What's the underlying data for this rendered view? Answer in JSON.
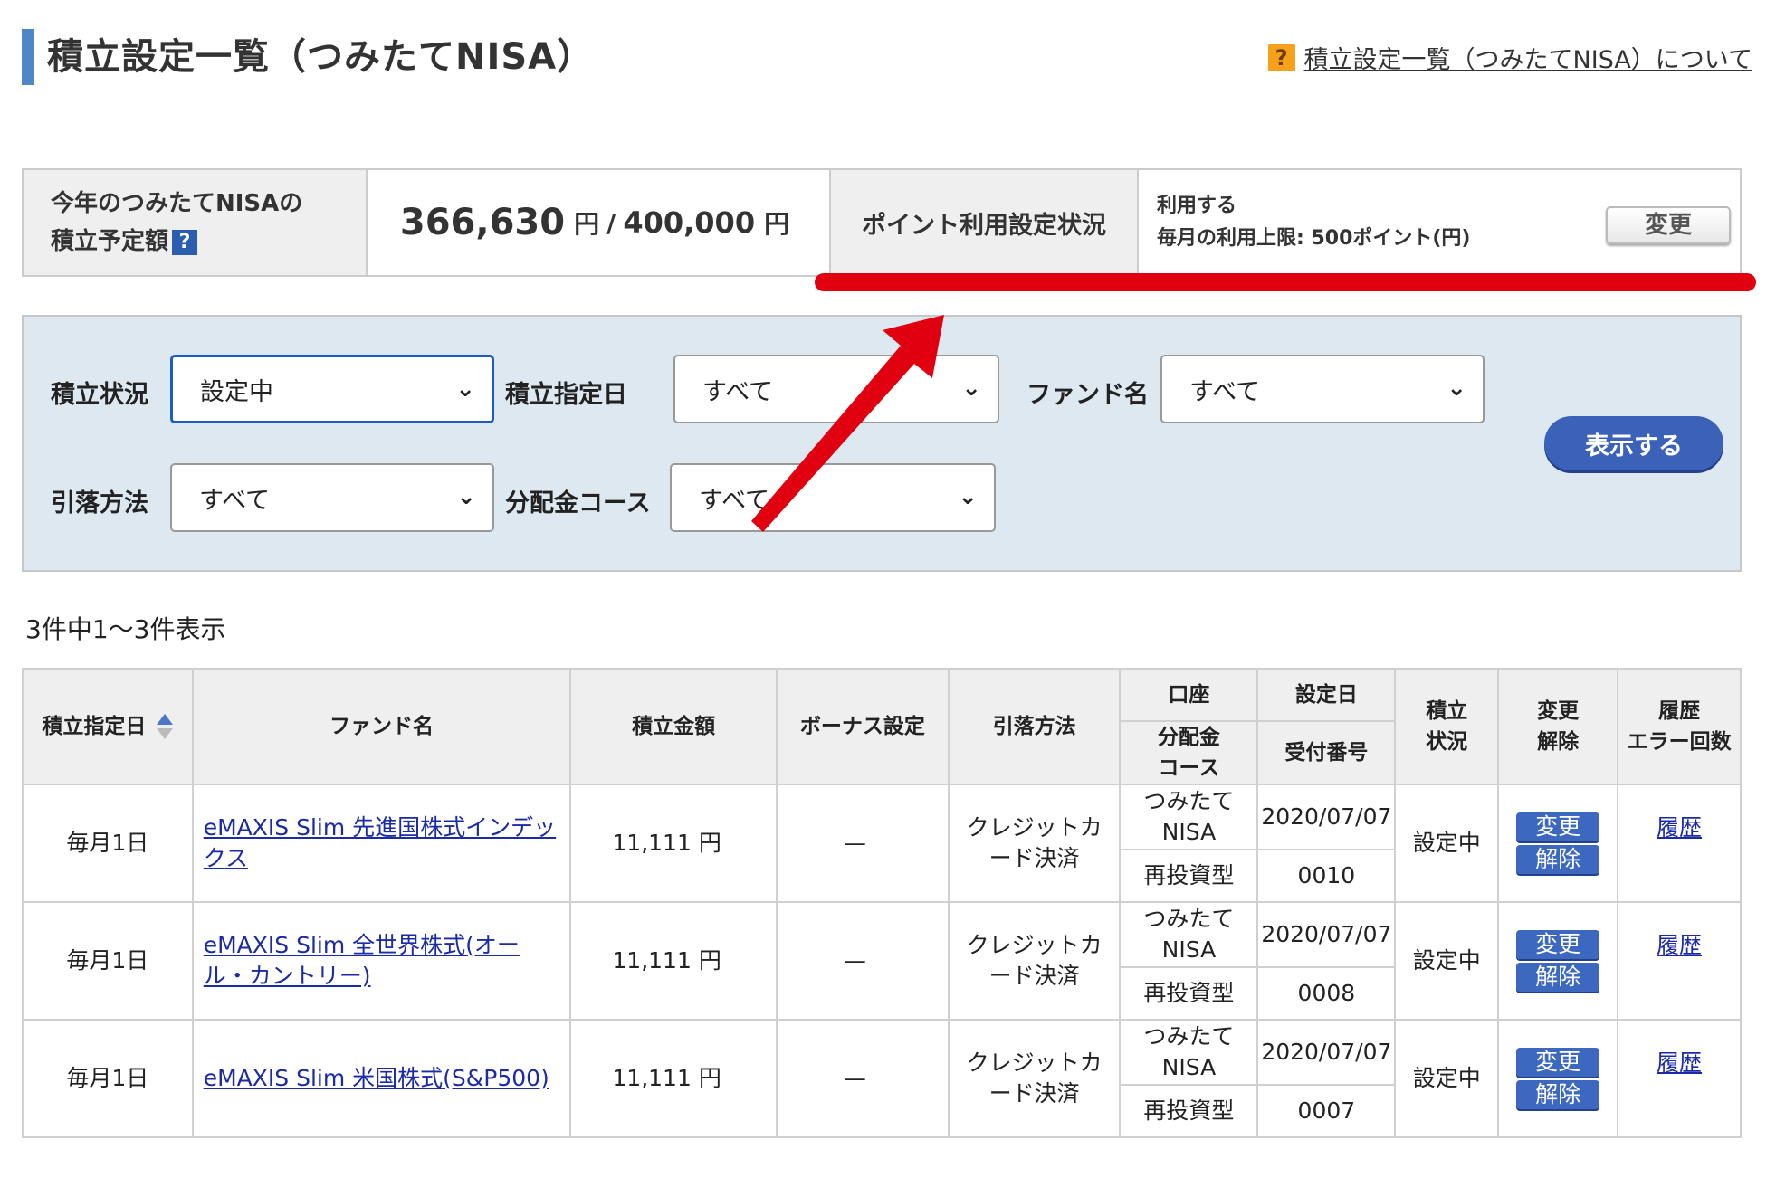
{
  "header": {
    "title": "積立設定一覧（つみたてNISA）",
    "help_link": "積立設定一覧（つみたてNISA）について",
    "help_icon": "question-icon"
  },
  "summary": {
    "plan_label_line1": "今年のつみたてNISAの",
    "plan_label_line2": "積立予定額",
    "plan_help": "?",
    "current_amount": "366,630",
    "unit": "円",
    "separator": "/",
    "limit_amount": "400,000",
    "limit_unit": "円",
    "point_label": "ポイント利用設定状況",
    "point_status": "利用する",
    "point_limit": "毎月の利用上限: 500ポイント(円)",
    "change_button": "変更"
  },
  "filters": {
    "status_label": "積立状況",
    "status_value": "設定中",
    "date_label": "積立指定日",
    "date_value": "すべて",
    "fund_label": "ファンド名",
    "fund_value": "すべて",
    "method_label": "引落方法",
    "method_value": "すべて",
    "course_label": "分配金コース",
    "course_value": "すべて",
    "submit_button": "表示する"
  },
  "result_count": "3件中1～3件表示",
  "table": {
    "headers": {
      "date": "積立指定日",
      "fund": "ファンド名",
      "amount": "積立金額",
      "bonus": "ボーナス設定",
      "method": "引落方法",
      "account": "口座",
      "course_line1": "分配金",
      "course_line2": "コース",
      "setdate": "設定日",
      "receipt": "受付番号",
      "status_line1": "積立",
      "status_line2": "状況",
      "change_line1": "変更",
      "change_line2": "解除",
      "history_line1": "履歴",
      "history_line2": "エラー回数"
    },
    "rows": [
      {
        "date": "毎月1日",
        "fund": "eMAXIS Slim 先進国株式インデックス",
        "amount": "11,111 円",
        "bonus": "—",
        "method": "クレジットカード決済",
        "account": "つみたてNISA",
        "course": "再投資型",
        "setdate": "2020/07/07",
        "receipt": "0010",
        "status": "設定中",
        "change": "変更",
        "cancel": "解除",
        "history": "履歴"
      },
      {
        "date": "毎月1日",
        "fund": "eMAXIS Slim 全世界株式(オール・カントリー)",
        "amount": "11,111 円",
        "bonus": "—",
        "method": "クレジットカード決済",
        "account": "つみたてNISA",
        "course": "再投資型",
        "setdate": "2020/07/07",
        "receipt": "0008",
        "status": "設定中",
        "change": "変更",
        "cancel": "解除",
        "history": "履歴"
      },
      {
        "date": "毎月1日",
        "fund": "eMAXIS Slim 米国株式(S&P500)",
        "amount": "11,111 円",
        "bonus": "—",
        "method": "クレジットカード決済",
        "account": "つみたてNISA",
        "course": "再投資型",
        "setdate": "2020/07/07",
        "receipt": "0007",
        "status": "設定中",
        "change": "変更",
        "cancel": "解除",
        "history": "履歴"
      }
    ]
  },
  "annotation_color": "#e00010"
}
